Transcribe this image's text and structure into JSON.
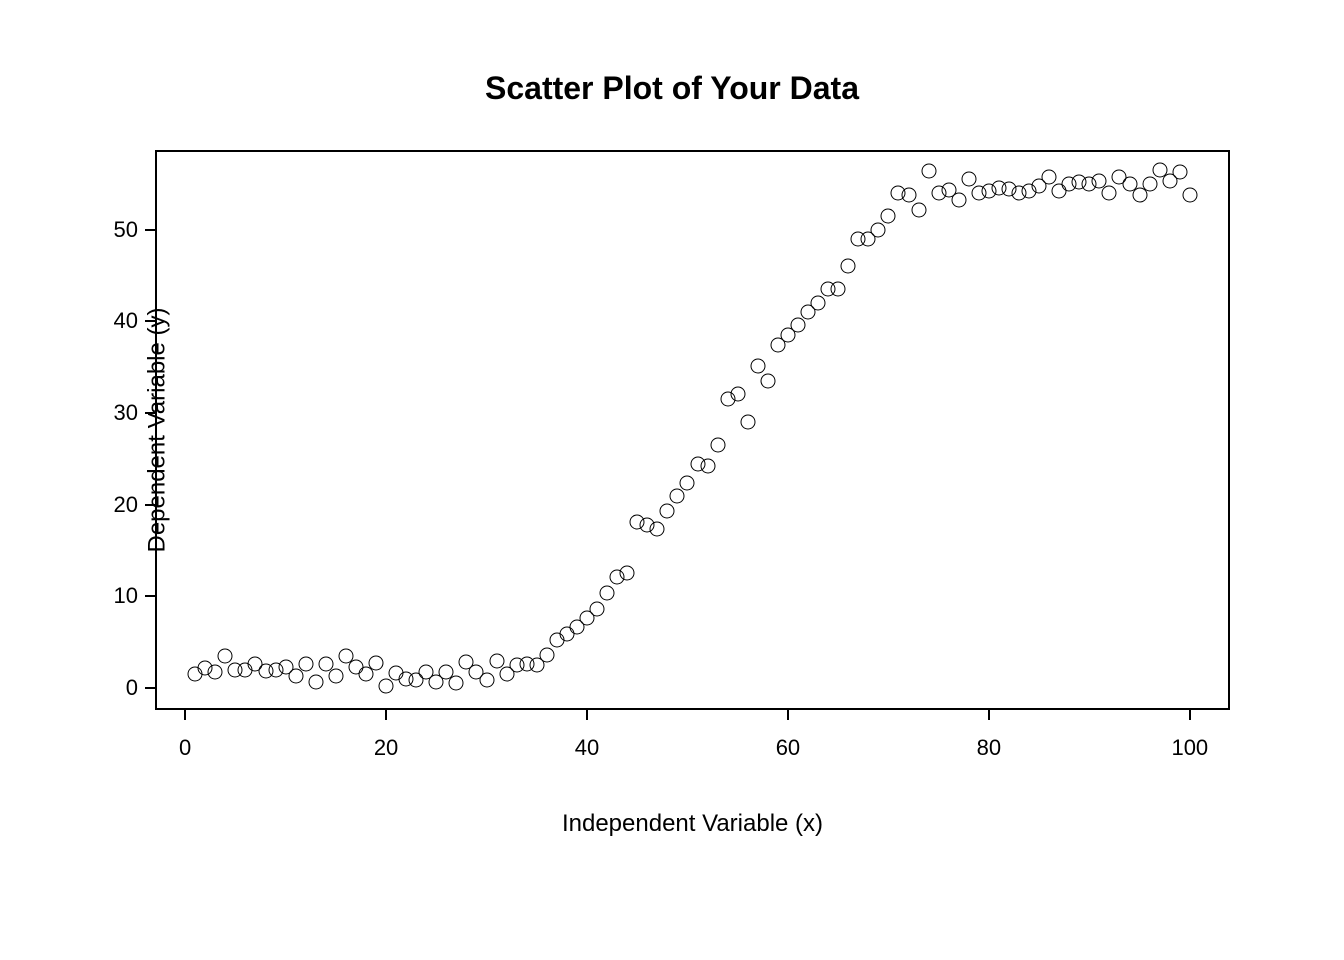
{
  "chart_data": {
    "type": "scatter",
    "title": "Scatter Plot of Your Data",
    "xlabel": "Independent Variable (x)",
    "ylabel": "Dependent Variable (y)",
    "xlim": [
      -3,
      104
    ],
    "ylim": [
      -2.4,
      58.7
    ],
    "xticks": [
      0,
      20,
      40,
      60,
      80,
      100
    ],
    "yticks": [
      0,
      10,
      20,
      30,
      40,
      50
    ],
    "x": [
      1,
      2,
      3,
      4,
      5,
      6,
      7,
      8,
      9,
      10,
      11,
      12,
      13,
      14,
      15,
      16,
      17,
      18,
      19,
      20,
      21,
      22,
      23,
      24,
      25,
      26,
      27,
      28,
      29,
      30,
      31,
      32,
      33,
      34,
      35,
      36,
      37,
      38,
      39,
      40,
      41,
      42,
      43,
      44,
      45,
      46,
      47,
      48,
      49,
      50,
      51,
      52,
      53,
      54,
      55,
      56,
      57,
      58,
      59,
      60,
      61,
      62,
      63,
      64,
      65,
      66,
      67,
      68,
      69,
      70,
      71,
      72,
      73,
      74,
      75,
      76,
      77,
      78,
      79,
      80,
      81,
      82,
      83,
      84,
      85,
      86,
      87,
      88,
      89,
      90,
      91,
      92,
      93,
      94,
      95,
      96,
      97,
      98,
      99,
      100
    ],
    "y": [
      1.5,
      2.2,
      1.8,
      3.5,
      2.0,
      2.0,
      2.6,
      1.9,
      2.0,
      2.3,
      1.3,
      2.6,
      0.7,
      2.6,
      1.3,
      3.5,
      2.3,
      1.5,
      2.7,
      0.2,
      1.6,
      1.0,
      0.9,
      1.7,
      0.7,
      1.7,
      0.5,
      2.8,
      1.7,
      0.9,
      3.0,
      1.5,
      2.5,
      2.6,
      2.5,
      3.6,
      5.2,
      5.9,
      6.7,
      7.6,
      8.6,
      10.4,
      12.1,
      12.6,
      18.1,
      17.8,
      17.3,
      19.3,
      21.0,
      22.4,
      24.4,
      24.2,
      26.5,
      31.5,
      32.1,
      29.0,
      35.1,
      33.5,
      37.4,
      38.5,
      39.6,
      41.0,
      42.0,
      43.5,
      43.5,
      46.0,
      49.0,
      49.0,
      50.0,
      51.5,
      54.0,
      53.8,
      52.1,
      56.4,
      54.0,
      54.3,
      53.2,
      55.5,
      54.0,
      54.2,
      54.6,
      54.4,
      54.0,
      54.2,
      54.8,
      55.8,
      54.2,
      55.0,
      55.2,
      55.0,
      55.3,
      54.0,
      55.7,
      55.0,
      53.8,
      55.0,
      56.5,
      55.3,
      56.3,
      53.8
    ]
  }
}
